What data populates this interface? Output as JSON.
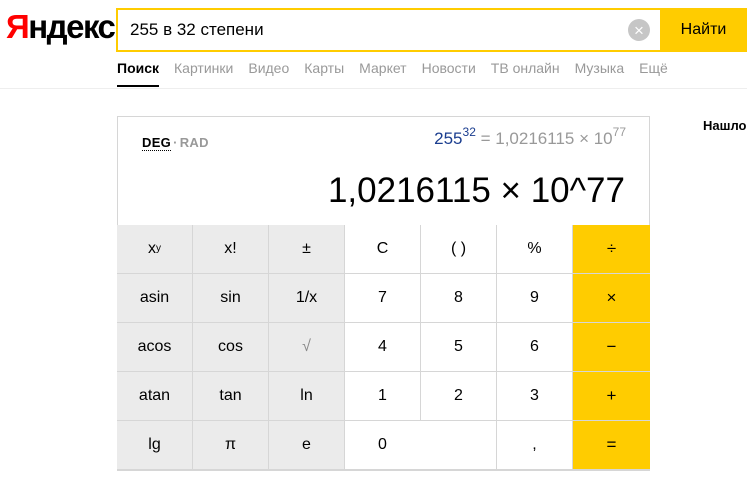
{
  "logo": {
    "first": "Я",
    "rest": "ндекс"
  },
  "search": {
    "value": "255 в 32 степени",
    "clear_icon": "×",
    "button_label": "Найти"
  },
  "nav": {
    "tabs": [
      {
        "label": "Поиск",
        "active": true
      },
      {
        "label": "Картинки"
      },
      {
        "label": "Видео"
      },
      {
        "label": "Карты"
      },
      {
        "label": "Маркет"
      },
      {
        "label": "Новости"
      },
      {
        "label": "ТВ онлайн"
      },
      {
        "label": "Музыка"
      },
      {
        "label": "Ещё"
      }
    ]
  },
  "right_panel": {
    "text": "Нашло"
  },
  "calculator": {
    "mode_deg": "DEG",
    "mode_sep": "·",
    "mode_rad": "RAD",
    "expression": {
      "base": "255",
      "exponent": "32",
      "rest": " = 1,0216115 × 10",
      "result_exponent": "77"
    },
    "display": "1,0216115 × 10^77",
    "keys": {
      "xy_base": "x",
      "xy_sup": "y",
      "factorial": "x!",
      "plusminus": "±",
      "clear": "C",
      "parens": "( )",
      "percent": "%",
      "divide": "÷",
      "asin": "asin",
      "sin": "sin",
      "reciprocal": "1/x",
      "k7": "7",
      "k8": "8",
      "k9": "9",
      "multiply": "×",
      "acos": "acos",
      "cos": "cos",
      "sqrt": "√",
      "k4": "4",
      "k5": "5",
      "k6": "6",
      "minus": "−",
      "atan": "atan",
      "tan": "tan",
      "ln": "ln",
      "k1": "1",
      "k2": "2",
      "k3": "3",
      "plus": "+",
      "lg": "lg",
      "pi": "π",
      "e": "e",
      "k0": "0",
      "comma": ",",
      "equals": "="
    }
  },
  "colors": {
    "accent": "#ffcc00",
    "logo_red": "#ff0000",
    "func_key_bg": "#ebebeb"
  }
}
